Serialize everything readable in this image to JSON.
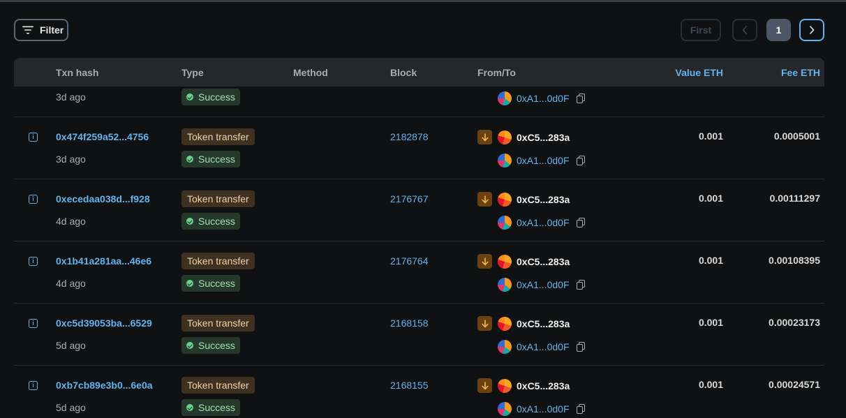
{
  "toolbar": {
    "filter_label": "Filter"
  },
  "pagination": {
    "first_label": "First",
    "current_page": "1"
  },
  "table": {
    "headers": {
      "txn_hash": "Txn hash",
      "type": "Type",
      "method": "Method",
      "block": "Block",
      "from_to": "From/To",
      "value": "Value ETH",
      "fee": "Fee ETH"
    },
    "partial_row": {
      "age": "3d ago",
      "status": "Success",
      "to": "0xA1...0d0F"
    },
    "rows": [
      {
        "hash": "0x474f259a52...4756",
        "age": "3d ago",
        "type": "Token transfer",
        "status": "Success",
        "block": "2182878",
        "from": "0xC5...283a",
        "to": "0xA1...0d0F",
        "value": "0.001",
        "fee": "0.0005001"
      },
      {
        "hash": "0xecedaa038d...f928",
        "age": "4d ago",
        "type": "Token transfer",
        "status": "Success",
        "block": "2176767",
        "from": "0xC5...283a",
        "to": "0xA1...0d0F",
        "value": "0.001",
        "fee": "0.00111297"
      },
      {
        "hash": "0x1b41a281aa...46e6",
        "age": "4d ago",
        "type": "Token transfer",
        "status": "Success",
        "block": "2176764",
        "from": "0xC5...283a",
        "to": "0xA1...0d0F",
        "value": "0.001",
        "fee": "0.00108395"
      },
      {
        "hash": "0xc5d39053ba...6529",
        "age": "5d ago",
        "type": "Token transfer",
        "status": "Success",
        "block": "2168158",
        "from": "0xC5...283a",
        "to": "0xA1...0d0F",
        "value": "0.001",
        "fee": "0.00023173"
      },
      {
        "hash": "0xb7cb89e3b0...6e0a",
        "age": "5d ago",
        "type": "Token transfer",
        "status": "Success",
        "block": "2168155",
        "from": "0xC5...283a",
        "to": "0xA1...0d0F",
        "value": "0.001",
        "fee": "0.00024571"
      }
    ]
  },
  "colors": {
    "background": "#101112",
    "accent": "#63b3ed",
    "success": "#68d391",
    "token_badge": "#3e3122"
  },
  "icons": {
    "filter": "filter-lines-icon",
    "info": "info-square-icon",
    "direction": "arrow-down-icon",
    "copy": "copy-icon",
    "success": "check-circle-icon",
    "prev": "chevron-left-icon",
    "next": "chevron-right-icon"
  }
}
